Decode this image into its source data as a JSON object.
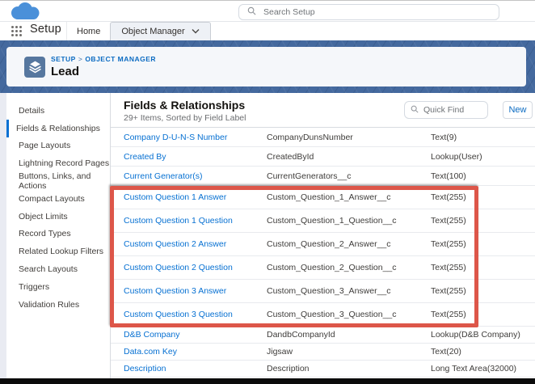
{
  "global": {
    "search_placeholder": "Search Setup",
    "app_label": "Setup",
    "tabs": [
      {
        "label": "Home",
        "active": false
      },
      {
        "label": "Object Manager",
        "active": true
      }
    ]
  },
  "page_header": {
    "breadcrumb_parts": [
      "SETUP",
      "OBJECT MANAGER"
    ],
    "breadcrumb_separator": ">",
    "title": "Lead"
  },
  "sidebar": {
    "active_index": 1,
    "items": [
      "Details",
      "Fields & Relationships",
      "Page Layouts",
      "Lightning Record Pages",
      "Buttons, Links, and Actions",
      "Compact Layouts",
      "Object Limits",
      "Record Types",
      "Related Lookup Filters",
      "Search Layouts",
      "Triggers",
      "Validation Rules"
    ]
  },
  "main": {
    "title": "Fields & Relationships",
    "subtitle": "29+ Items, Sorted by Field Label",
    "quick_find_placeholder": "Quick Find",
    "new_button_label": "New"
  },
  "table": {
    "rows": [
      {
        "label": "Company D-U-N-S Number",
        "api": "CompanyDunsNumber",
        "type": "Text(9)",
        "highlighted": false
      },
      {
        "label": "Created By",
        "api": "CreatedById",
        "type": "Lookup(User)",
        "highlighted": false
      },
      {
        "label": "Current Generator(s)",
        "api": "CurrentGenerators__c",
        "type": "Text(100)",
        "highlighted": false
      },
      {
        "label": "Custom Question 1 Answer",
        "api": "Custom_Question_1_Answer__c",
        "type": "Text(255)",
        "highlighted": true
      },
      {
        "label": "Custom Question 1 Question",
        "api": "Custom_Question_1_Question__c",
        "type": "Text(255)",
        "highlighted": true
      },
      {
        "label": "Custom Question 2 Answer",
        "api": "Custom_Question_2_Answer__c",
        "type": "Text(255)",
        "highlighted": true
      },
      {
        "label": "Custom Question 2 Question",
        "api": "Custom_Question_2_Question__c",
        "type": "Text(255)",
        "highlighted": true
      },
      {
        "label": "Custom Question 3 Answer",
        "api": "Custom_Question_3_Answer__c",
        "type": "Text(255)",
        "highlighted": true
      },
      {
        "label": "Custom Question 3 Question",
        "api": "Custom_Question_3_Question__c",
        "type": "Text(255)",
        "highlighted": true
      },
      {
        "label": "D&B Company",
        "api": "DandbCompanyId",
        "type": "Lookup(D&B Company)",
        "highlighted": false
      },
      {
        "label": "Data.com Key",
        "api": "Jigsaw",
        "type": "Text(20)",
        "highlighted": false
      },
      {
        "label": "Description",
        "api": "Description",
        "type": "Long Text Area(32000)",
        "highlighted": false
      }
    ]
  },
  "colors": {
    "banner_blue": "#44699e",
    "link_blue": "#0670d2",
    "brand_cloud_blue": "#4a90d9",
    "object_icon_blue": "#56779f",
    "highlight_red": "#dd5649",
    "active_tab_bg": "#eef1f6"
  }
}
